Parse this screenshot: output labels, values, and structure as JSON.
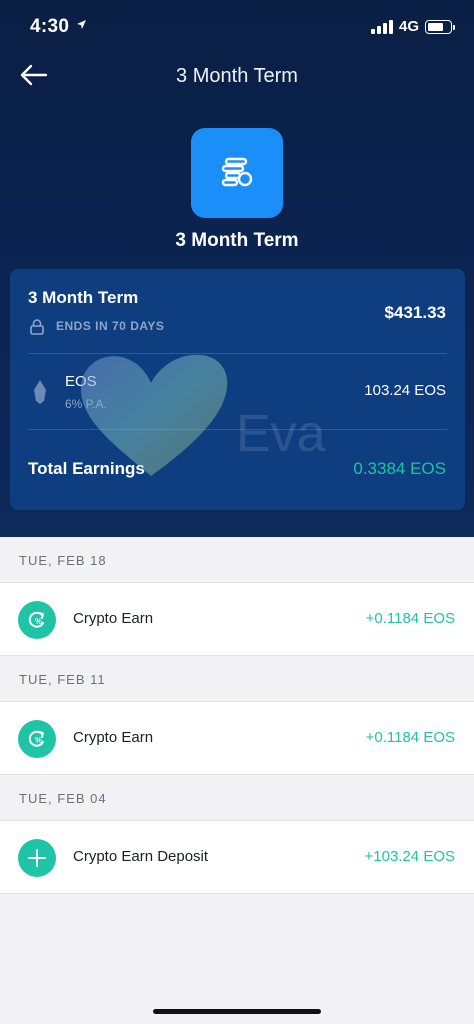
{
  "status_bar": {
    "time": "4:30",
    "network": "4G",
    "location_icon": "location-arrow-icon",
    "signal_icon": "signal-bars-icon",
    "battery_icon": "battery-icon",
    "battery_level": 0.7
  },
  "nav": {
    "title": "3 Month Term",
    "back_icon": "back-arrow-icon"
  },
  "hero": {
    "icon": "coin-stack-icon",
    "title": "3 Month Term"
  },
  "summary_card": {
    "term_title": "3 Month Term",
    "lock_icon": "lock-icon",
    "ends_text": "ENDS IN 70 DAYS",
    "term_amount": "$431.33",
    "asset": {
      "icon": "eos-icon",
      "name": "EOS",
      "rate": "6% P.A.",
      "amount": "103.24 EOS"
    },
    "total_label": "Total Earnings",
    "total_value": "0.3384 EOS",
    "watermark_text": "Eva"
  },
  "transactions": [
    {
      "date": "TUE, FEB 18",
      "items": [
        {
          "icon": "crypto-earn-icon",
          "name": "Crypto Earn",
          "amount": "+0.1184 EOS"
        }
      ]
    },
    {
      "date": "TUE, FEB 11",
      "items": [
        {
          "icon": "crypto-earn-icon",
          "name": "Crypto Earn",
          "amount": "+0.1184 EOS"
        }
      ]
    },
    {
      "date": "TUE, FEB 04",
      "items": [
        {
          "icon": "plus-icon",
          "name": "Crypto Earn Deposit",
          "amount": "+103.24 EOS"
        }
      ]
    }
  ],
  "colors": {
    "hero_bg": "#0b2452",
    "card_bg": "#0f3e80",
    "accent_blue": "#1a8ffa",
    "positive_green": "#1fc3a6"
  }
}
